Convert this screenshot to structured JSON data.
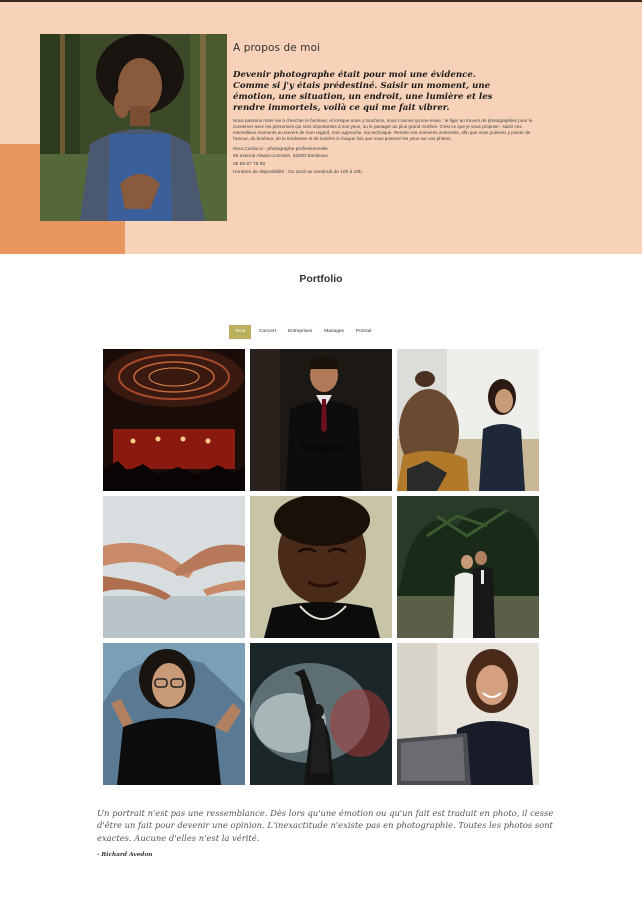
{
  "about": {
    "title": "A propos de moi",
    "lead_lines": [
      "Devenir photographe était pour moi une évidence.",
      "Comme si j'y étais prédestiné. Saisir un moment, une",
      "émotion, une situation, un endroit, une lumière et les",
      "rendre immortels, voilà ce qui me fait vibrer."
    ],
    "body": "Nous passons notre vie à chercher le bonheur, et lorsque nous y touchons, nous n'avons qu'une envie : le figer au travers de photographies pour le conserver avec les personnes qui sont importantes à nos yeux, ou le partager au plus grand nombre. C'est ce que je vous propose : saisir ces merveilleux moments au travers de mon regard, mon approche, ma technique. Rendre vos moments immortels, afin que vous puissiez y puiser de l'amour, du bonheur, de la tendresse et de lumière à chaque fois que vous poserez les yeux sur vos photos.",
    "contact": {
      "name": "Nina Carducci - photographe professionnelle",
      "address": "66 avenue Alsace-Lorraine, 33200 Bordeaux",
      "phone": "05 56 67 78 89",
      "hours": "Horaires de disponibilité : Du lundi au vendredi de 10h à 19h."
    }
  },
  "portfolio": {
    "title": "Portfolio",
    "filters": [
      "Tous",
      "Concert",
      "Entreprises",
      "Mariages",
      "Portrait"
    ],
    "active_filter": "Tous"
  },
  "quote": {
    "lines": [
      "Un portrait n'est pas une ressemblance. Dès lors qu'une émotion ou qu'un fait est traduit en photo, il cesse",
      "d'être un fait pour devenir une opinion. L'inexactitude n'existe pas en photographie. Toutes les photos sont",
      "exactes. Aucune d'elles n'est la vérité."
    ],
    "author": "- Richard Avedon"
  },
  "colors": {
    "about_background": "#f7d1b8",
    "about_accent": "#e8985f",
    "active_filter": "#b8b05a"
  }
}
